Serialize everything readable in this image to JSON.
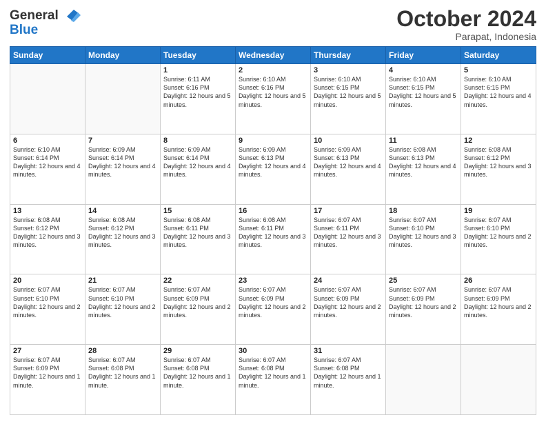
{
  "header": {
    "logo_line1": "General",
    "logo_line2": "Blue",
    "month": "October 2024",
    "location": "Parapat, Indonesia"
  },
  "weekdays": [
    "Sunday",
    "Monday",
    "Tuesday",
    "Wednesday",
    "Thursday",
    "Friday",
    "Saturday"
  ],
  "weeks": [
    [
      {
        "day": "",
        "info": ""
      },
      {
        "day": "",
        "info": ""
      },
      {
        "day": "1",
        "info": "Sunrise: 6:11 AM\nSunset: 6:16 PM\nDaylight: 12 hours\nand 5 minutes."
      },
      {
        "day": "2",
        "info": "Sunrise: 6:10 AM\nSunset: 6:16 PM\nDaylight: 12 hours\nand 5 minutes."
      },
      {
        "day": "3",
        "info": "Sunrise: 6:10 AM\nSunset: 6:15 PM\nDaylight: 12 hours\nand 5 minutes."
      },
      {
        "day": "4",
        "info": "Sunrise: 6:10 AM\nSunset: 6:15 PM\nDaylight: 12 hours\nand 5 minutes."
      },
      {
        "day": "5",
        "info": "Sunrise: 6:10 AM\nSunset: 6:15 PM\nDaylight: 12 hours\nand 4 minutes."
      }
    ],
    [
      {
        "day": "6",
        "info": "Sunrise: 6:10 AM\nSunset: 6:14 PM\nDaylight: 12 hours\nand 4 minutes."
      },
      {
        "day": "7",
        "info": "Sunrise: 6:09 AM\nSunset: 6:14 PM\nDaylight: 12 hours\nand 4 minutes."
      },
      {
        "day": "8",
        "info": "Sunrise: 6:09 AM\nSunset: 6:14 PM\nDaylight: 12 hours\nand 4 minutes."
      },
      {
        "day": "9",
        "info": "Sunrise: 6:09 AM\nSunset: 6:13 PM\nDaylight: 12 hours\nand 4 minutes."
      },
      {
        "day": "10",
        "info": "Sunrise: 6:09 AM\nSunset: 6:13 PM\nDaylight: 12 hours\nand 4 minutes."
      },
      {
        "day": "11",
        "info": "Sunrise: 6:08 AM\nSunset: 6:13 PM\nDaylight: 12 hours\nand 4 minutes."
      },
      {
        "day": "12",
        "info": "Sunrise: 6:08 AM\nSunset: 6:12 PM\nDaylight: 12 hours\nand 3 minutes."
      }
    ],
    [
      {
        "day": "13",
        "info": "Sunrise: 6:08 AM\nSunset: 6:12 PM\nDaylight: 12 hours\nand 3 minutes."
      },
      {
        "day": "14",
        "info": "Sunrise: 6:08 AM\nSunset: 6:12 PM\nDaylight: 12 hours\nand 3 minutes."
      },
      {
        "day": "15",
        "info": "Sunrise: 6:08 AM\nSunset: 6:11 PM\nDaylight: 12 hours\nand 3 minutes."
      },
      {
        "day": "16",
        "info": "Sunrise: 6:08 AM\nSunset: 6:11 PM\nDaylight: 12 hours\nand 3 minutes."
      },
      {
        "day": "17",
        "info": "Sunrise: 6:07 AM\nSunset: 6:11 PM\nDaylight: 12 hours\nand 3 minutes."
      },
      {
        "day": "18",
        "info": "Sunrise: 6:07 AM\nSunset: 6:10 PM\nDaylight: 12 hours\nand 3 minutes."
      },
      {
        "day": "19",
        "info": "Sunrise: 6:07 AM\nSunset: 6:10 PM\nDaylight: 12 hours\nand 2 minutes."
      }
    ],
    [
      {
        "day": "20",
        "info": "Sunrise: 6:07 AM\nSunset: 6:10 PM\nDaylight: 12 hours\nand 2 minutes."
      },
      {
        "day": "21",
        "info": "Sunrise: 6:07 AM\nSunset: 6:10 PM\nDaylight: 12 hours\nand 2 minutes."
      },
      {
        "day": "22",
        "info": "Sunrise: 6:07 AM\nSunset: 6:09 PM\nDaylight: 12 hours\nand 2 minutes."
      },
      {
        "day": "23",
        "info": "Sunrise: 6:07 AM\nSunset: 6:09 PM\nDaylight: 12 hours\nand 2 minutes."
      },
      {
        "day": "24",
        "info": "Sunrise: 6:07 AM\nSunset: 6:09 PM\nDaylight: 12 hours\nand 2 minutes."
      },
      {
        "day": "25",
        "info": "Sunrise: 6:07 AM\nSunset: 6:09 PM\nDaylight: 12 hours\nand 2 minutes."
      },
      {
        "day": "26",
        "info": "Sunrise: 6:07 AM\nSunset: 6:09 PM\nDaylight: 12 hours\nand 2 minutes."
      }
    ],
    [
      {
        "day": "27",
        "info": "Sunrise: 6:07 AM\nSunset: 6:09 PM\nDaylight: 12 hours\nand 1 minute."
      },
      {
        "day": "28",
        "info": "Sunrise: 6:07 AM\nSunset: 6:08 PM\nDaylight: 12 hours\nand 1 minute."
      },
      {
        "day": "29",
        "info": "Sunrise: 6:07 AM\nSunset: 6:08 PM\nDaylight: 12 hours\nand 1 minute."
      },
      {
        "day": "30",
        "info": "Sunrise: 6:07 AM\nSunset: 6:08 PM\nDaylight: 12 hours\nand 1 minute."
      },
      {
        "day": "31",
        "info": "Sunrise: 6:07 AM\nSunset: 6:08 PM\nDaylight: 12 hours\nand 1 minute."
      },
      {
        "day": "",
        "info": ""
      },
      {
        "day": "",
        "info": ""
      }
    ]
  ]
}
